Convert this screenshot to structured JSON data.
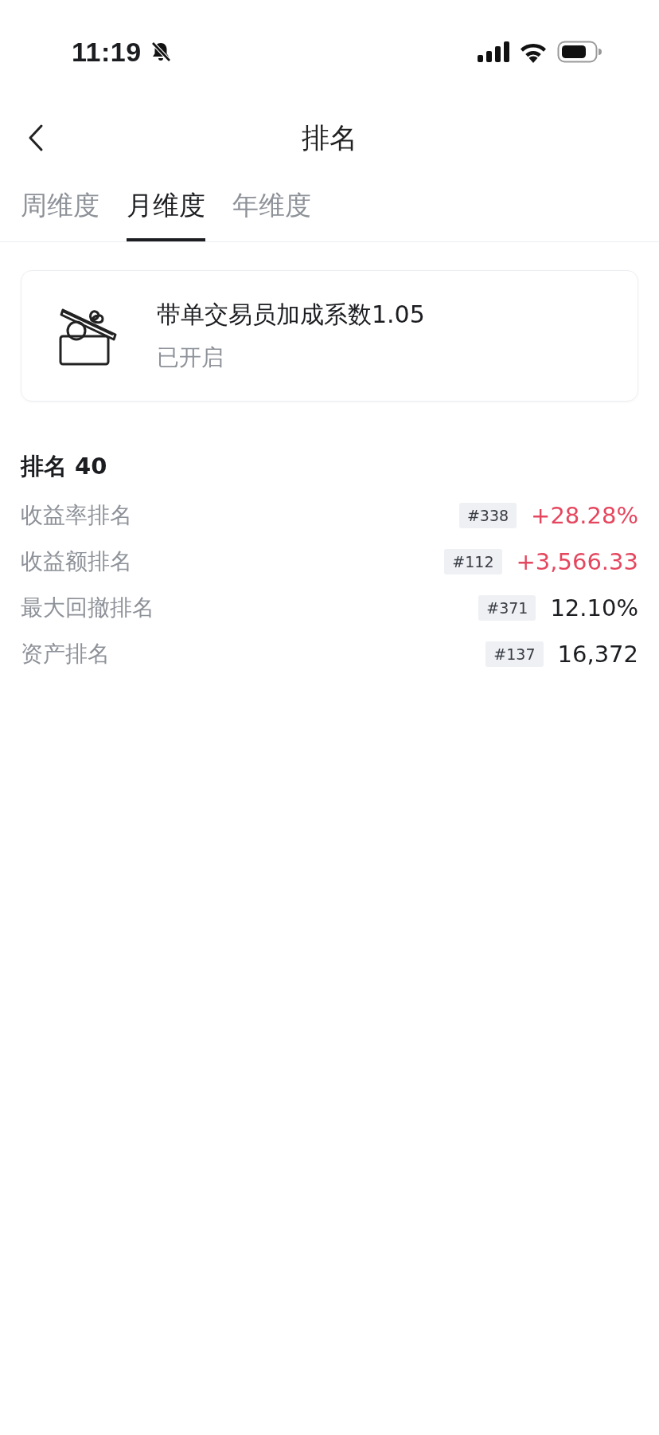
{
  "status_bar": {
    "time": "11:19"
  },
  "header": {
    "title": "排名"
  },
  "tabs": [
    {
      "label": "周维度",
      "selected": false
    },
    {
      "label": "月维度",
      "selected": true
    },
    {
      "label": "年维度",
      "selected": false
    }
  ],
  "bonus_card": {
    "title": "带单交易员加成系数1.05",
    "status": "已开启"
  },
  "ranking": {
    "heading": "排名 40",
    "rows": [
      {
        "label": "收益率排名",
        "rank": "#338",
        "value": "+28.28%",
        "color": "#e5475f"
      },
      {
        "label": "收益额排名",
        "rank": "#112",
        "value": "+3,566.33",
        "color": "#e5475f"
      },
      {
        "label": "最大回撤排名",
        "rank": "#371",
        "value": "12.10%",
        "color": "#1c1d21"
      },
      {
        "label": "资产排名",
        "rank": "#137",
        "value": "16,372",
        "color": "#1c1d21"
      }
    ]
  }
}
